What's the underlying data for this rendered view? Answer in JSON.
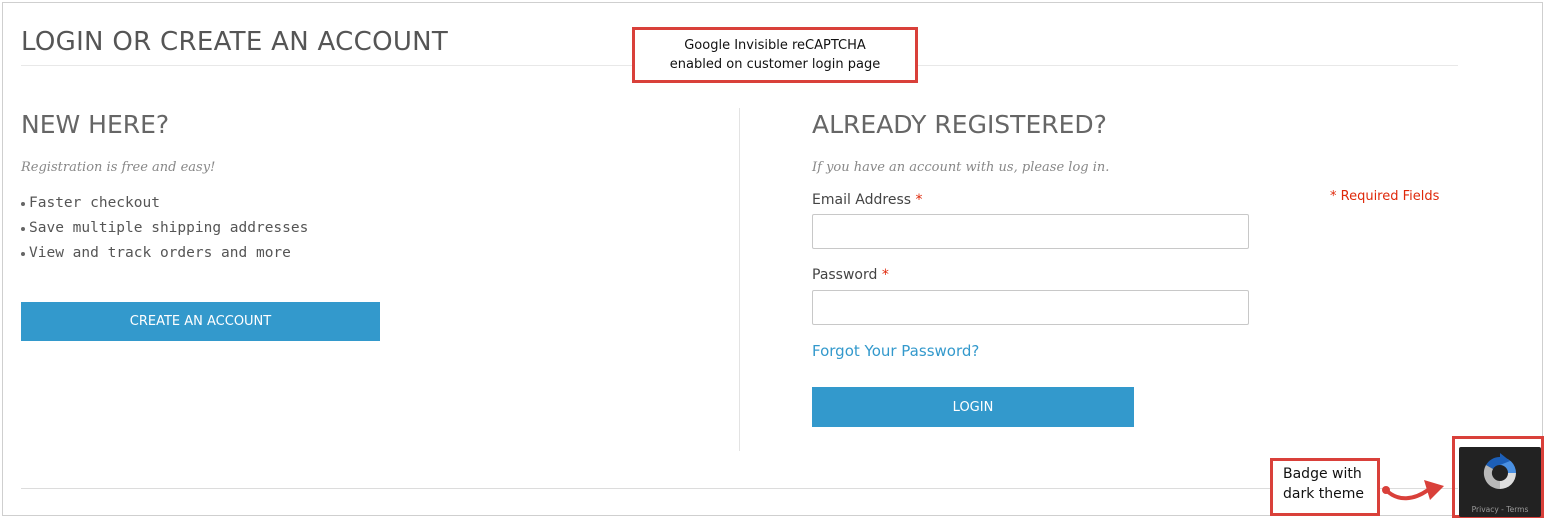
{
  "page": {
    "title": "LOGIN OR CREATE AN ACCOUNT"
  },
  "new_customer": {
    "title": "NEW HERE?",
    "subtitle": "Registration is free and easy!",
    "benefits": [
      "Faster checkout",
      "Save multiple shipping addresses",
      "View and track orders and more"
    ],
    "create_button_label": "CREATE AN ACCOUNT"
  },
  "registered": {
    "title": "ALREADY REGISTERED?",
    "subtitle": "If you have an account with us, please log in.",
    "required_note": "* Required Fields",
    "email_label": "Email Address",
    "password_label": "Password",
    "required_marker": "*",
    "email_value": "",
    "password_value": "",
    "forgot_link": "Forgot Your Password?",
    "login_button_label": "LOGIN"
  },
  "annotations": {
    "top_callout_line1": "Google Invisible reCAPTCHA",
    "top_callout_line2": "enabled on customer login page",
    "badge_callout_line1": "Badge with",
    "badge_callout_line2": "dark theme",
    "accent_color": "#d9403a"
  },
  "recaptcha_badge": {
    "footer": "Privacy - Terms",
    "icon": "recaptcha-logo-icon",
    "theme": "dark"
  },
  "colors": {
    "button": "#3399cc",
    "link": "#3399cc",
    "required": "#df280a"
  }
}
